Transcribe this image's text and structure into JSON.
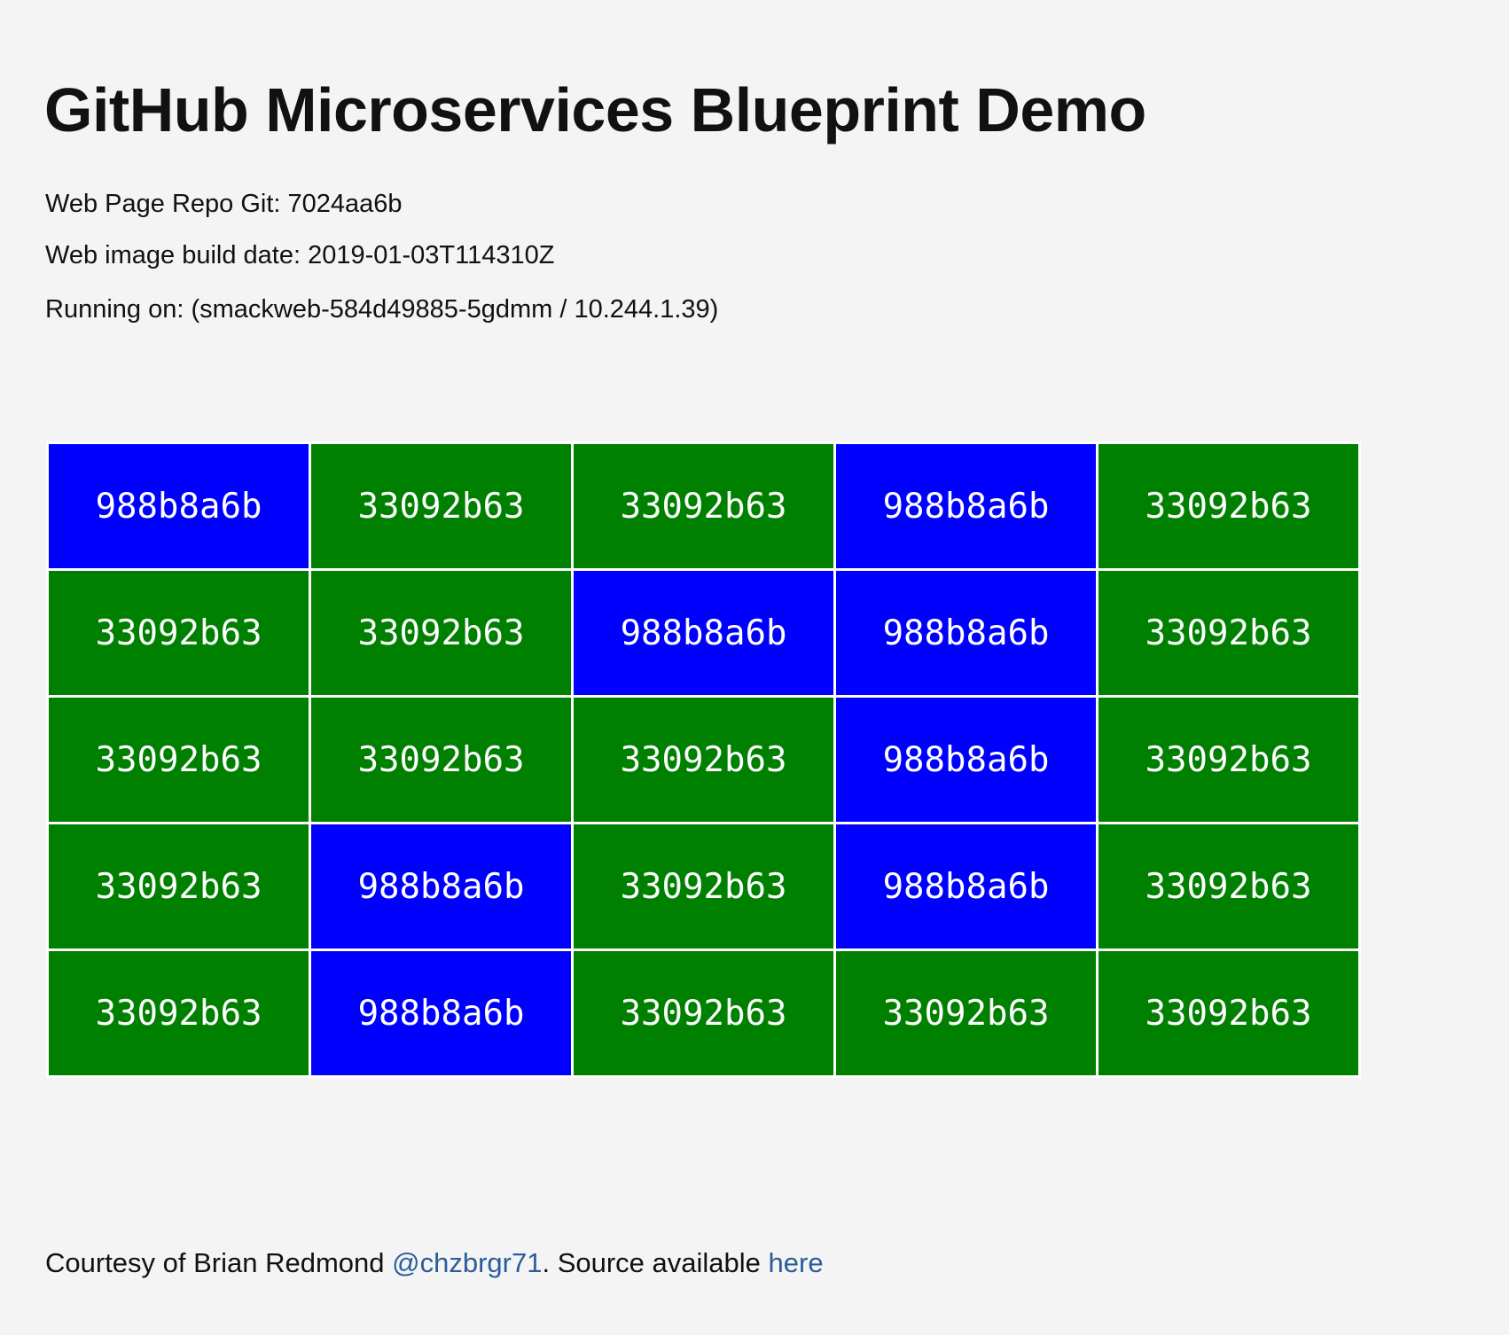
{
  "header": {
    "title": "GitHub Microservices Blueprint Demo",
    "repo_git": "Web Page Repo Git: 7024aa6b",
    "build_date": "Web image build date: 2019-01-03T114310Z",
    "running_on": "Running on: (smackweb-584d49885-5gdmm / 10.244.1.39)"
  },
  "colors": {
    "988b8a6b": "#0000ff",
    "33092b63": "#008000"
  },
  "grid": [
    [
      "988b8a6b",
      "33092b63",
      "33092b63",
      "988b8a6b",
      "33092b63"
    ],
    [
      "33092b63",
      "33092b63",
      "988b8a6b",
      "988b8a6b",
      "33092b63"
    ],
    [
      "33092b63",
      "33092b63",
      "33092b63",
      "988b8a6b",
      "33092b63"
    ],
    [
      "33092b63",
      "988b8a6b",
      "33092b63",
      "988b8a6b",
      "33092b63"
    ],
    [
      "33092b63",
      "988b8a6b",
      "33092b63",
      "33092b63",
      "33092b63"
    ]
  ],
  "footer": {
    "prefix": "Courtesy of Brian Redmond ",
    "twitter_link": "@chzbrgr71",
    "middle": ". Source available ",
    "source_link": "here"
  }
}
